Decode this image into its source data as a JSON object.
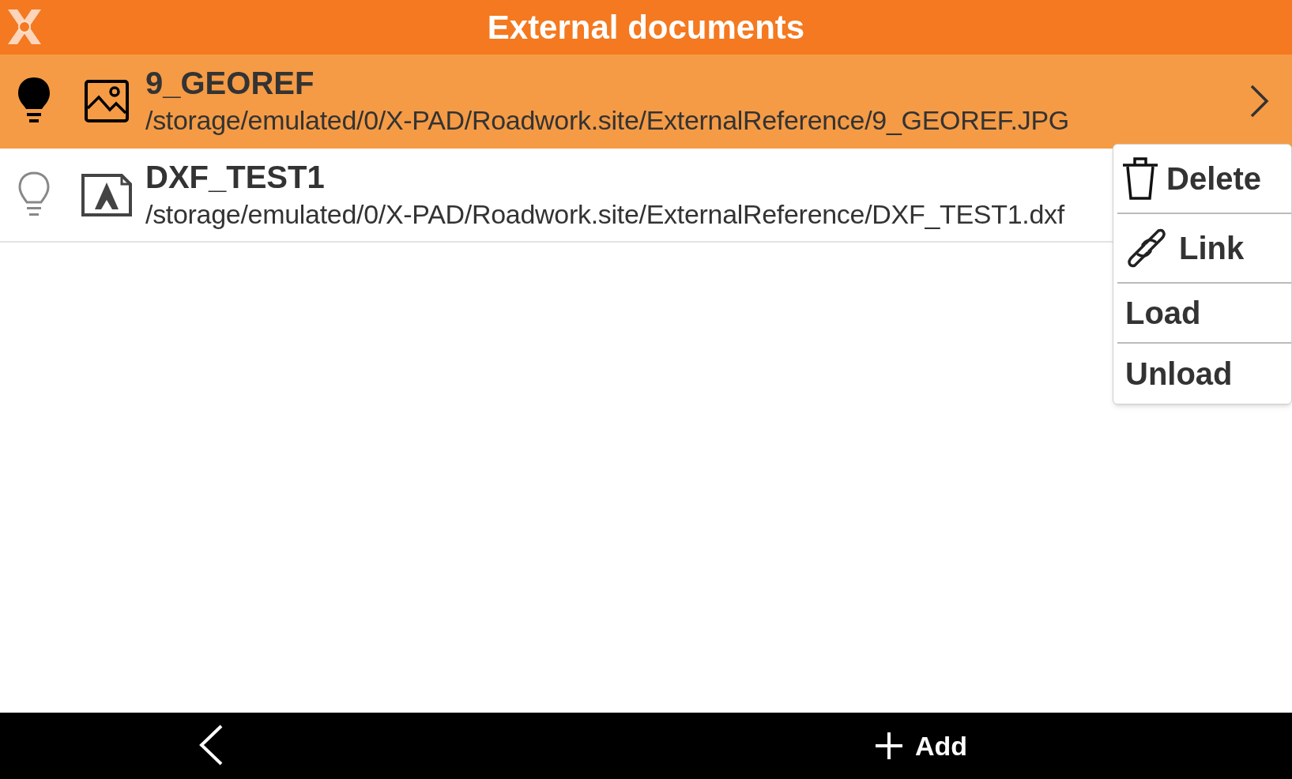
{
  "header": {
    "title": "External documents"
  },
  "documents": [
    {
      "name": "9_GEOREF",
      "path": "/storage/emulated/0/X-PAD/Roadwork.site/ExternalReference/9_GEOREF.JPG",
      "kind": "image",
      "on": true,
      "selected": true
    },
    {
      "name": "DXF_TEST1",
      "path": "/storage/emulated/0/X-PAD/Roadwork.site/ExternalReference/DXF_TEST1.dxf",
      "kind": "cad",
      "on": false,
      "selected": false
    }
  ],
  "context_menu": [
    {
      "label": "Delete",
      "kind": "delete"
    },
    {
      "label": "Link",
      "kind": "link"
    },
    {
      "label": "Load",
      "kind": "plain"
    },
    {
      "label": "Unload",
      "kind": "plain"
    }
  ],
  "bottom_bar": {
    "add_label": "Add"
  }
}
